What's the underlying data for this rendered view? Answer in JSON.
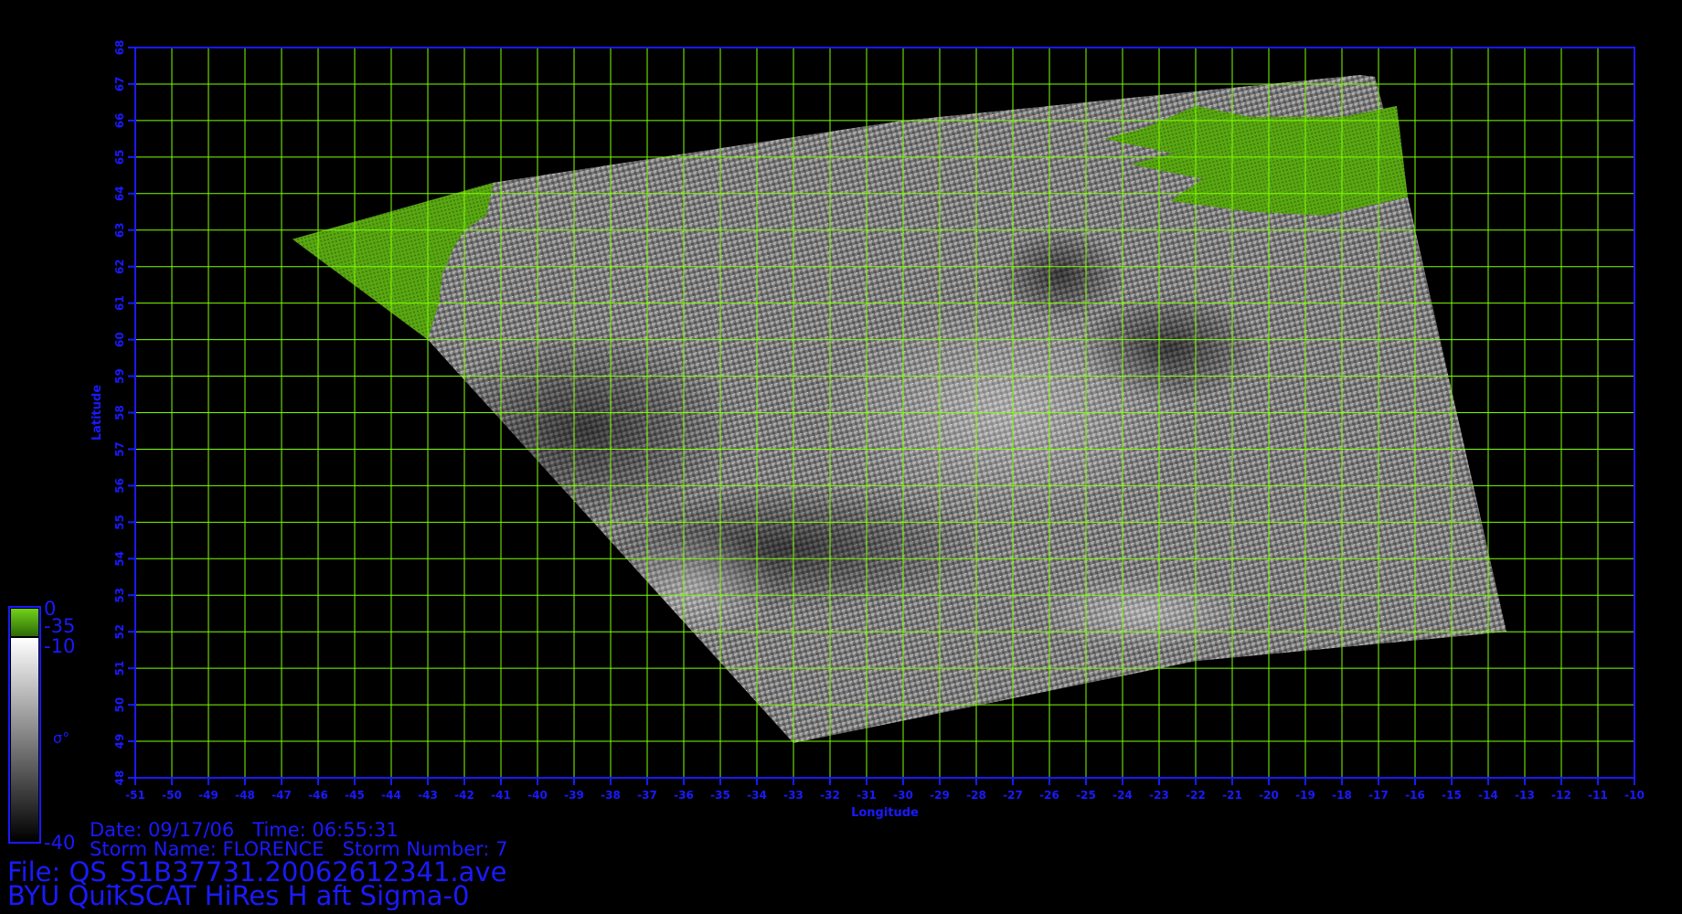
{
  "map": {
    "x_axis_label": "Longitude",
    "y_axis_label": "Latitude",
    "lon_range": [
      -51,
      -10
    ],
    "lat_range": [
      48,
      68
    ],
    "grid_color": "#7fff00",
    "frame_color": "#1a1aff",
    "land_color": "#4a9a10",
    "lon_ticks": [
      "-51",
      "-50",
      "-49",
      "-48",
      "-47",
      "-46",
      "-45",
      "-44",
      "-43",
      "-42",
      "-41",
      "-40",
      "-39",
      "-38",
      "-37",
      "-36",
      "-35",
      "-34",
      "-33",
      "-32",
      "-31",
      "-30",
      "-29",
      "-28",
      "-27",
      "-26",
      "-25",
      "-24",
      "-23",
      "-22",
      "-21",
      "-20",
      "-19",
      "-18",
      "-17",
      "-16",
      "-15",
      "-14",
      "-13",
      "-12",
      "-11",
      "-10"
    ],
    "lat_ticks": [
      "48",
      "49",
      "50",
      "51",
      "52",
      "53",
      "54",
      "55",
      "56",
      "57",
      "58",
      "59",
      "60",
      "61",
      "62",
      "63",
      "64",
      "65",
      "66",
      "67",
      "68"
    ]
  },
  "colorbar": {
    "land_top": "0",
    "land_bottom": "-35",
    "sigma_top": "-10",
    "sigma_bottom": "-40",
    "symbol": "σ°"
  },
  "info": {
    "date_line": "Date: 09/17/06   Time: 06:55:31",
    "storm_line": "Storm Name: FLORENCE   Storm Number: 7",
    "file_line": "File: QS_S1B37731.20062612341.ave",
    "product_line": "BYU QuikSCAT HiRes H aft Sigma-0"
  }
}
